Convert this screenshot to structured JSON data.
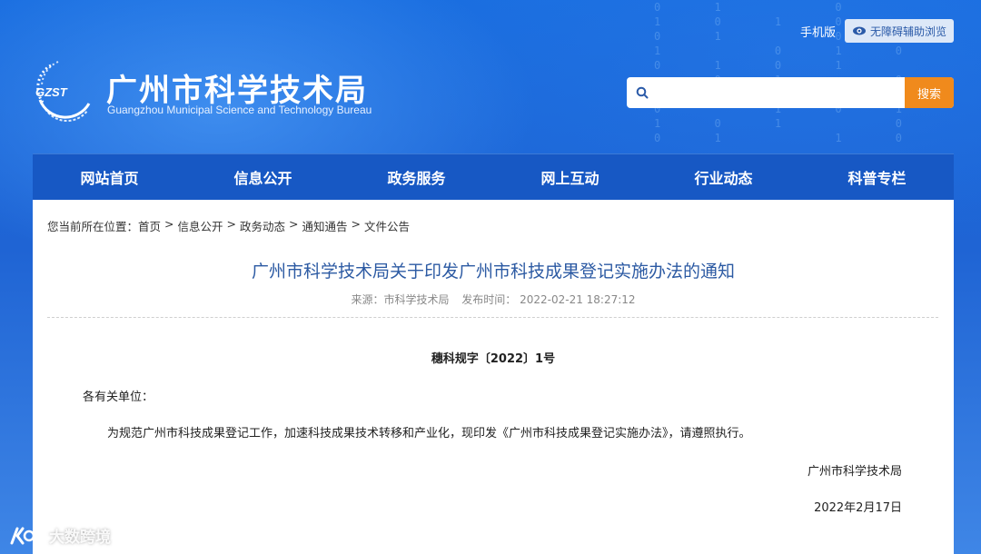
{
  "header": {
    "title_cn": "广州市科学技术局",
    "title_en": "Guangzhou Municipal Science and Technology Bureau",
    "logo_text": "GZST",
    "mobile_link": "手机版",
    "accessibility_label": "无障碍辅助浏览",
    "search": {
      "placeholder": "",
      "button_label": "搜索"
    }
  },
  "nav": {
    "items": [
      {
        "label": "网站首页"
      },
      {
        "label": "信息公开"
      },
      {
        "label": "政务服务"
      },
      {
        "label": "网上互动"
      },
      {
        "label": "行业动态"
      },
      {
        "label": "科普专栏"
      }
    ]
  },
  "breadcrumb": {
    "prefix": "您当前所在位置：",
    "separator": ">",
    "items": [
      "首页",
      "信息公开",
      "政务动态",
      "通知通告",
      "文件公告"
    ]
  },
  "article": {
    "title": "广州市科学技术局关于印发广州市科技成果登记实施办法的通知",
    "source": "来源：市科学技术局",
    "published": "发布时间： 2022-02-21 18:27:12",
    "doc_number": "穗科规字〔2022〕1号",
    "salutation": "各有关单位：",
    "body": "为规范广州市科技成果登记工作，加速科技成果技术转移和产业化，现印发《广州市科技成果登记实施办法》，请遵照执行。",
    "signature": "广州市科学技术局",
    "date": "2022年2月17日"
  },
  "watermark": {
    "text": "大数跨境"
  },
  "colors": {
    "header_blue": "#1c63cf",
    "nav_blue": "#1758c4",
    "search_orange": "#f08a1c",
    "title_blue": "#2c5aa3"
  },
  "icons": {
    "search": "search-icon",
    "accessibility": "eye-icon",
    "logo": "gzst-logo"
  }
}
